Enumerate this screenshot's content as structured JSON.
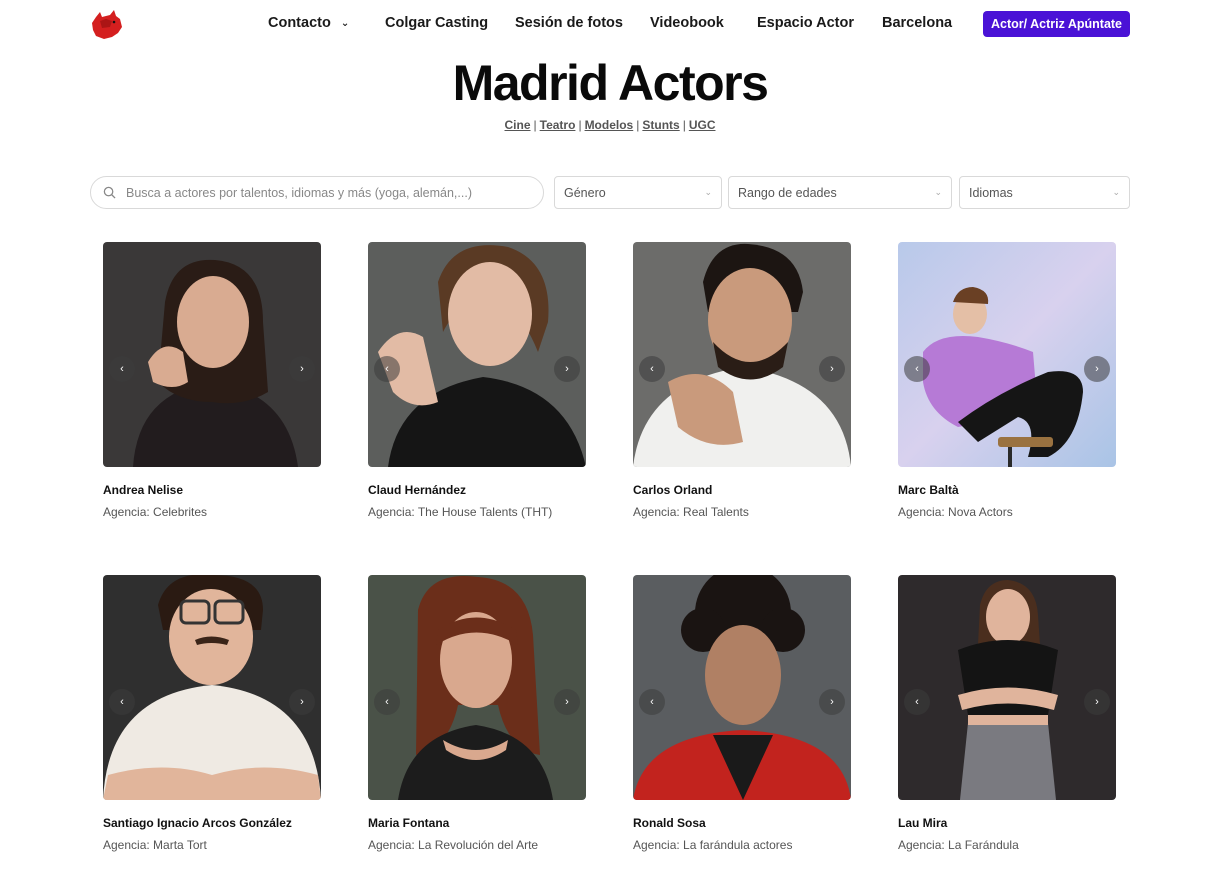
{
  "nav": {
    "items": [
      {
        "label": "Contacto",
        "has_dropdown": true
      },
      {
        "label": "Colgar Casting"
      },
      {
        "label": "Sesión de fotos"
      },
      {
        "label": "Videobook"
      },
      {
        "label": "Espacio Actor"
      },
      {
        "label": "Barcelona"
      }
    ],
    "cta_label": "Actor/ Actriz Apúntate"
  },
  "page_title": "Madrid Actors",
  "categories": [
    "Cine",
    "Teatro",
    "Modelos",
    "Stunts",
    "UGC"
  ],
  "filters": {
    "search_placeholder": "Busca a actores por talentos, idiomas y más (yoga, alemán,...)",
    "gender_label": "Género",
    "age_label": "Rango de edades",
    "language_label": "Idiomas"
  },
  "actors": [
    {
      "name": "Andrea Nelise",
      "agency": "Agencia: Celebrites"
    },
    {
      "name": "Claud Hernández",
      "agency": "Agencia: The House Talents (THT)"
    },
    {
      "name": "Carlos Orland",
      "agency": "Agencia: Real Talents"
    },
    {
      "name": "Marc Baltà",
      "agency": "Agencia: Nova Actors"
    },
    {
      "name": "Santiago Ignacio Arcos González",
      "agency": "Agencia: Marta Tort"
    },
    {
      "name": "Maria Fontana",
      "agency": "Agencia: La Revolución del Arte"
    },
    {
      "name": "Ronald Sosa",
      "agency": "Agencia: La farándula actores"
    },
    {
      "name": "Lau Mira",
      "agency": "Agencia: La Farándula"
    }
  ],
  "colors": {
    "accent": "#4a12d6",
    "logo": "#d41f1f"
  }
}
